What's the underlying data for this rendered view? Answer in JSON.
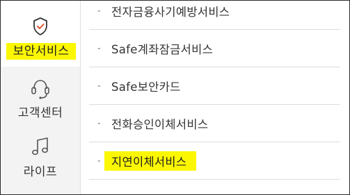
{
  "sidebar": {
    "items": [
      {
        "label": "보안서비스",
        "icon": "shield-check-icon",
        "active": true
      },
      {
        "label": "고객센터",
        "icon": "headset-icon",
        "active": false
      },
      {
        "label": "라이프",
        "icon": "music-note-icon",
        "active": false
      }
    ]
  },
  "menu": {
    "bullet": "-",
    "items": [
      {
        "label": "전자금융사기예방서비스"
      },
      {
        "label": "Safe계좌잠금서비스"
      },
      {
        "label": "Safe보안카드"
      },
      {
        "label": "전화승인이체서비스"
      },
      {
        "label": "지연이체서비스",
        "highlighted": true
      }
    ]
  },
  "colors": {
    "highlight": "#fbf700",
    "shield_check": "#e4532b",
    "sidebar_bg": "#f3f3f3",
    "text": "#333333"
  }
}
